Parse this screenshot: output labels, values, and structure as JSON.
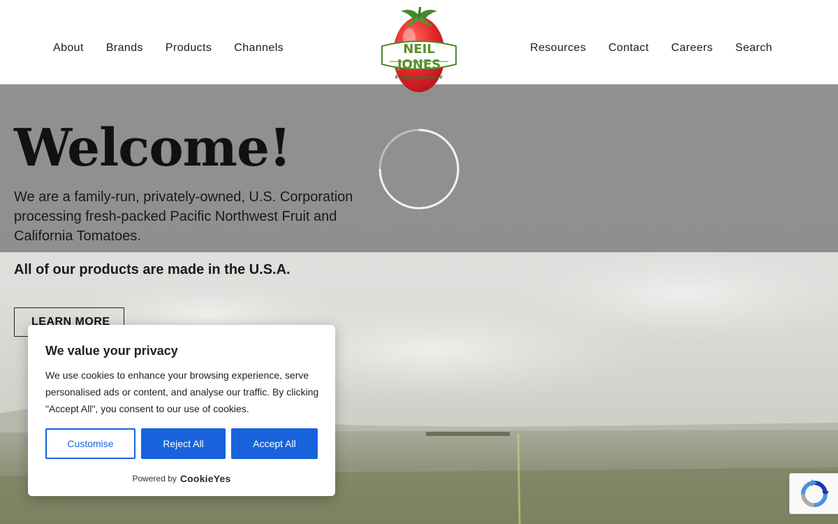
{
  "header": {
    "nav_left": [
      "About",
      "Brands",
      "Products",
      "Channels"
    ],
    "nav_right": [
      "Resources",
      "Contact",
      "Careers",
      "Search"
    ],
    "logo": {
      "line1": "NEIL JONES",
      "line2": "FOOD COMPANY",
      "icon": "tomato-logo-icon"
    }
  },
  "hero": {
    "title": "Welcome!",
    "intro": "We are a family-run, privately-owned, U.S. Corporation processing fresh-packed Pacific Northwest Fruit and California Tomatoes.",
    "made_in": "All of our products are made in the U.S.A.",
    "cta_label": "LEARN MORE",
    "loading_icon": "loading-spinner-icon"
  },
  "cookie_banner": {
    "title": "We value your privacy",
    "text": "We use cookies to enhance your browsing experience, serve personalised ads or content, and analyse our traffic. By clicking \"Accept All\", you consent to our use of cookies.",
    "buttons": {
      "customise": "Customise",
      "reject": "Reject All",
      "accept": "Accept All"
    },
    "powered_by": "Powered by",
    "brand": "CookieYes"
  },
  "recaptcha": {
    "icon": "recaptcha-icon"
  },
  "colors": {
    "accent_blue": "#1863dc",
    "tomato_red": "#e4252b",
    "logo_green": "#4c8a2c",
    "overlay_gray": "#8a8a8a"
  }
}
